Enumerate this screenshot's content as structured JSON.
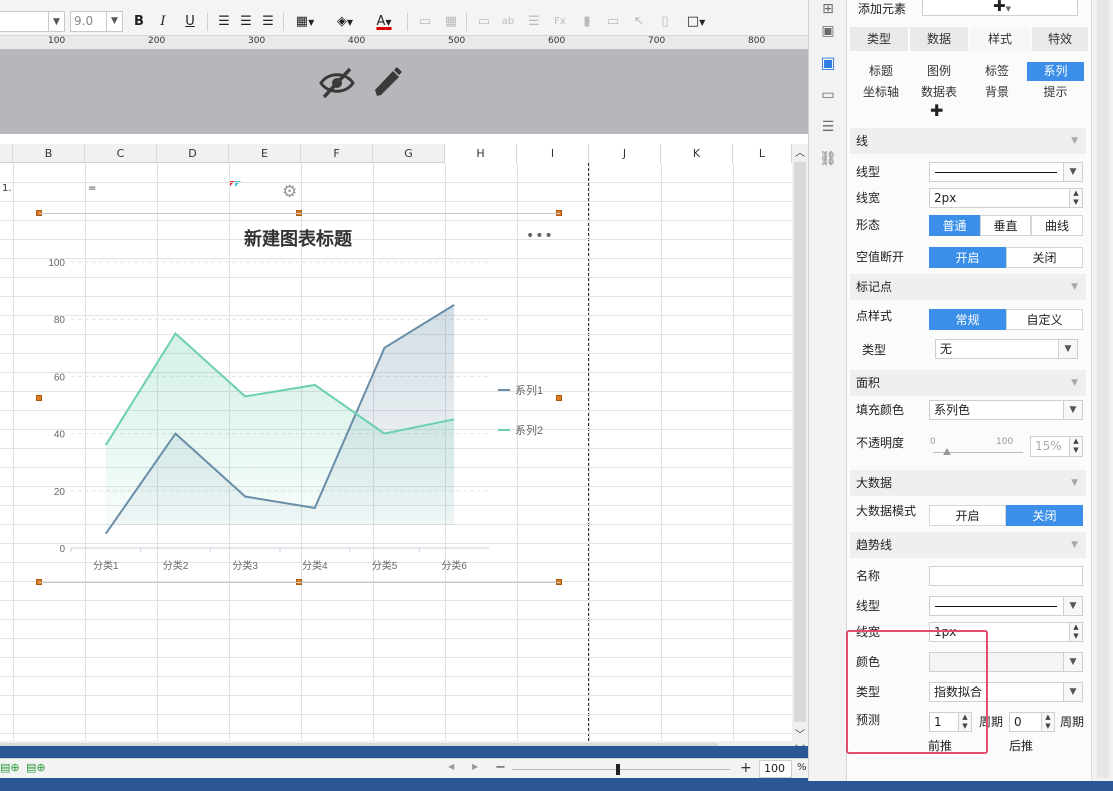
{
  "toolbar": {
    "font_size": "9.0",
    "bold": "B",
    "italic": "I",
    "underline": "U",
    "font_color_letter": "A"
  },
  "ruler": {
    "ticks": [
      "100",
      "200",
      "300",
      "400",
      "500",
      "600",
      "700",
      "800"
    ]
  },
  "sheet": {
    "columns": [
      "B",
      "C",
      "D",
      "E",
      "F",
      "G",
      "H",
      "I",
      "J",
      "K",
      "L"
    ],
    "row1_cell_a": "1.",
    "row1_cell_b": "="
  },
  "chart_data": {
    "type": "area",
    "title": "新建图表标题",
    "categories": [
      "分类1",
      "分类2",
      "分类3",
      "分类4",
      "分类5",
      "分类6"
    ],
    "series": [
      {
        "name": "系列1",
        "values": [
          5,
          40,
          18,
          14,
          70,
          85
        ],
        "color": "#6a8ea8"
      },
      {
        "name": "系列2",
        "values": [
          36,
          75,
          53,
          57,
          40,
          45
        ],
        "color": "#6ccfb0"
      }
    ],
    "ylim": [
      0,
      100
    ],
    "yticks": [
      "0",
      "20",
      "40",
      "60",
      "80",
      "100"
    ],
    "legend_position": "right",
    "grid": true
  },
  "status": {
    "zoom": "100",
    "percent": "%"
  },
  "panel": {
    "add_element_label": "添加元素",
    "tabs": [
      "类型",
      "数据",
      "样式",
      "特效"
    ],
    "active_tab": 2,
    "subtabs_row1": [
      "标题",
      "图例",
      "标签",
      "系列"
    ],
    "subtabs_row2": [
      "坐标轴",
      "数据表",
      "背景",
      "提示"
    ],
    "active_subtab": "系列",
    "line_section": "线",
    "line_type_label": "线型",
    "line_width_label": "线宽",
    "line_width_value": "2px",
    "shape_label": "形态",
    "shape_options": [
      "普通",
      "垂直",
      "曲线"
    ],
    "empty_break_label": "空值断开",
    "toggle_on": "开启",
    "toggle_off": "关闭",
    "marker_section": "标记点",
    "point_style_label": "点样式",
    "point_style_options": [
      "常规",
      "自定义"
    ],
    "marker_type_label": "类型",
    "marker_type_value": "无",
    "area_section": "面积",
    "fill_color_label": "填充颜色",
    "fill_color_value": "系列色",
    "opacity_label": "不透明度",
    "opacity_min": "0",
    "opacity_max": "100",
    "opacity_value": "15%",
    "opacity_level": 0.15,
    "bigdata_section": "大数据",
    "bigdata_mode_label": "大数据模式",
    "trend_section": "趋势线",
    "trend_name_label": "名称",
    "trend_line_type_label": "线型",
    "trend_line_width_label": "线宽",
    "trend_line_width_value": "1px",
    "trend_color_label": "颜色",
    "trend_type_label": "类型",
    "trend_type_value": "指数拟合",
    "forecast_label": "预测",
    "forecast_forward_value": "1",
    "forecast_backward_value": "0",
    "period_label": "周期",
    "forward_label": "前推",
    "backward_label": "后推"
  }
}
